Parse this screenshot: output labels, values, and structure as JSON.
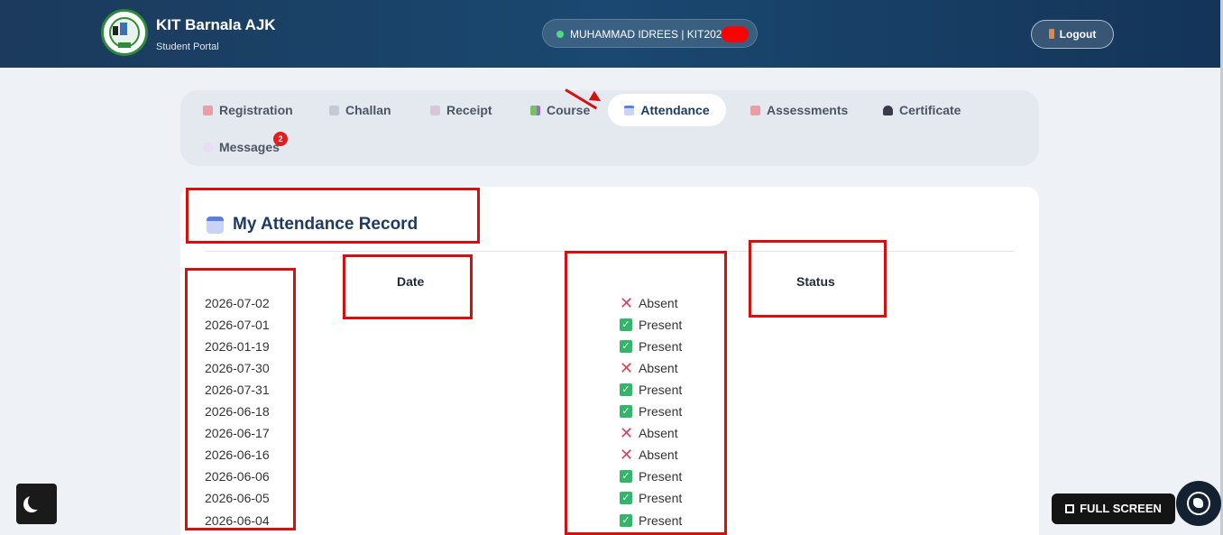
{
  "header": {
    "brand_title": "KIT Barnala AJK",
    "brand_subtitle": "Student Portal",
    "user_label": "MUHAMMAD IDREES | KIT2026",
    "logout_label": "Logout",
    "colors": {
      "bar": "#1b3a5c",
      "online_dot": "#4ade80"
    }
  },
  "tabs": [
    {
      "label": "Registration",
      "icon": "registration-icon",
      "active": false
    },
    {
      "label": "Challan",
      "icon": "challan-icon",
      "active": false
    },
    {
      "label": "Receipt",
      "icon": "receipt-icon",
      "active": false
    },
    {
      "label": "Course",
      "icon": "course-icon",
      "active": false
    },
    {
      "label": "Attendance",
      "icon": "calendar-icon",
      "active": true
    },
    {
      "label": "Assessments",
      "icon": "assessments-icon",
      "active": false
    },
    {
      "label": "Certificate",
      "icon": "graduation-cap-icon",
      "active": false
    },
    {
      "label": "Messages",
      "icon": "speech-bubble-icon",
      "active": false,
      "badge": "2"
    }
  ],
  "attendance": {
    "title": "My Attendance Record",
    "columns": {
      "date": "Date",
      "status": "Status"
    },
    "rows": [
      {
        "date": "2026-07-02",
        "status": "Absent"
      },
      {
        "date": "2026-07-01",
        "status": "Present"
      },
      {
        "date": "2026-01-19",
        "status": "Present"
      },
      {
        "date": "2026-07-30",
        "status": "Absent"
      },
      {
        "date": "2026-07-31",
        "status": "Present"
      },
      {
        "date": "2026-06-18",
        "status": "Present"
      },
      {
        "date": "2026-06-17",
        "status": "Absent"
      },
      {
        "date": "2026-06-16",
        "status": "Absent"
      },
      {
        "date": "2026-06-06",
        "status": "Present"
      },
      {
        "date": "2026-06-05",
        "status": "Present"
      },
      {
        "date": "2026-06-04",
        "status": "Present"
      }
    ],
    "colors": {
      "present": "#33b56a",
      "absent": "#e0415a"
    }
  },
  "floating": {
    "fullscreen_label": "FULL SCREEN",
    "theme_toggle_icon": "moon-icon",
    "chat_icon": "whatsapp-icon"
  },
  "annotation_color": "#d60f0f"
}
